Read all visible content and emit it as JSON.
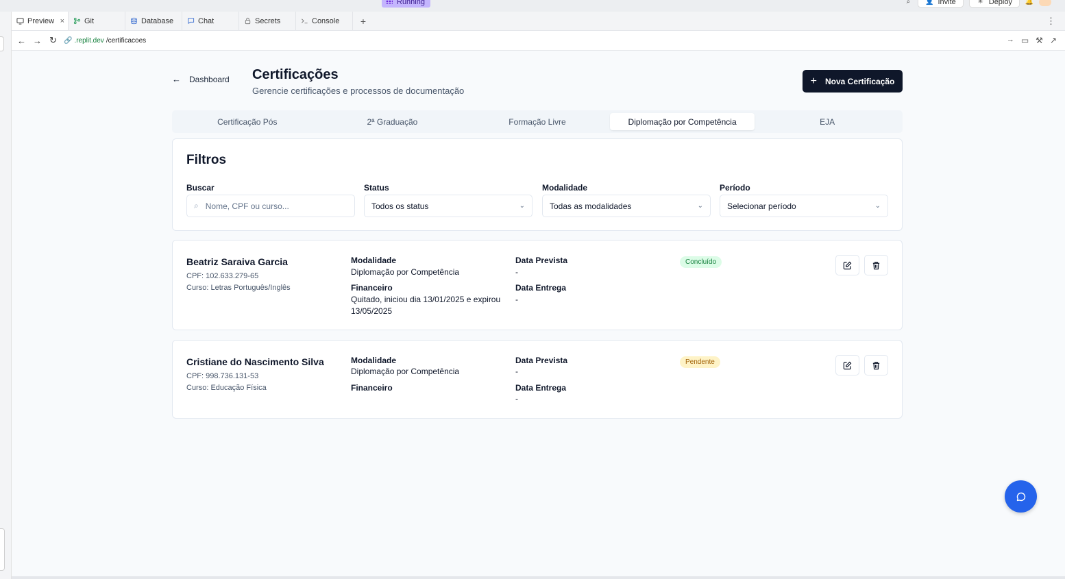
{
  "top": {
    "status": "Running",
    "invite_label": "Invite",
    "deploy_label": "Deploy"
  },
  "workspace_tabs": [
    {
      "label": "Preview",
      "icon": "monitor-icon",
      "active": true
    },
    {
      "label": "Git",
      "icon": "git-icon"
    },
    {
      "label": "Database",
      "icon": "database-icon"
    },
    {
      "label": "Chat",
      "icon": "chat-icon"
    },
    {
      "label": "Secrets",
      "icon": "lock-icon"
    },
    {
      "label": "Console",
      "icon": "terminal-icon"
    }
  ],
  "url": {
    "domain": ".replit.dev",
    "path": "/certificacoes"
  },
  "page": {
    "back_label": "Dashboard",
    "title": "Certificações",
    "subtitle": "Gerencie certificações e processos de documentação",
    "new_button": "Nova Certificação"
  },
  "category_tabs": [
    {
      "label": "Certificação Pós"
    },
    {
      "label": "2ª Graduação"
    },
    {
      "label": "Formação Livre"
    },
    {
      "label": "Diplomação por Competência",
      "active": true
    },
    {
      "label": "EJA"
    }
  ],
  "filters": {
    "title": "Filtros",
    "search": {
      "label": "Buscar",
      "placeholder": "Nome, CPF ou curso..."
    },
    "status": {
      "label": "Status",
      "value": "Todos os status"
    },
    "modalidade": {
      "label": "Modalidade",
      "value": "Todas as modalidades"
    },
    "periodo": {
      "label": "Período",
      "value": "Selecionar período"
    }
  },
  "records": [
    {
      "name": "Beatriz Saraiva Garcia",
      "cpf": "CPF: 102.633.279-65",
      "curso": "Curso: Letras Português/Inglês",
      "modalidade_label": "Modalidade",
      "modalidade": "Diplomação por Competência",
      "financeiro_label": "Financeiro",
      "financeiro_line1": "Quitado, iniciou dia 13/01/2025 e expirou",
      "financeiro_line2": "13/05/2025",
      "data_prevista_label": "Data Prevista",
      "data_prevista": "-",
      "data_entrega_label": "Data Entrega",
      "data_entrega": "-",
      "status": "Concluído",
      "status_color": "#15803d"
    },
    {
      "name": "Cristiane do Nascimento Silva",
      "cpf": "CPF: 998.736.131-53",
      "curso": "Curso: Educação Física",
      "modalidade_label": "Modalidade",
      "modalidade": "Diplomação por Competência",
      "financeiro_label": "Financeiro",
      "data_prevista_label": "Data Prevista",
      "data_prevista": "-",
      "data_entrega_label": "Data Entrega",
      "data_entrega": "-",
      "status": "Pendente",
      "status_color": "#a16207"
    }
  ],
  "colors": {
    "primary_button": "#0f172a",
    "fab": "#2563eb"
  }
}
